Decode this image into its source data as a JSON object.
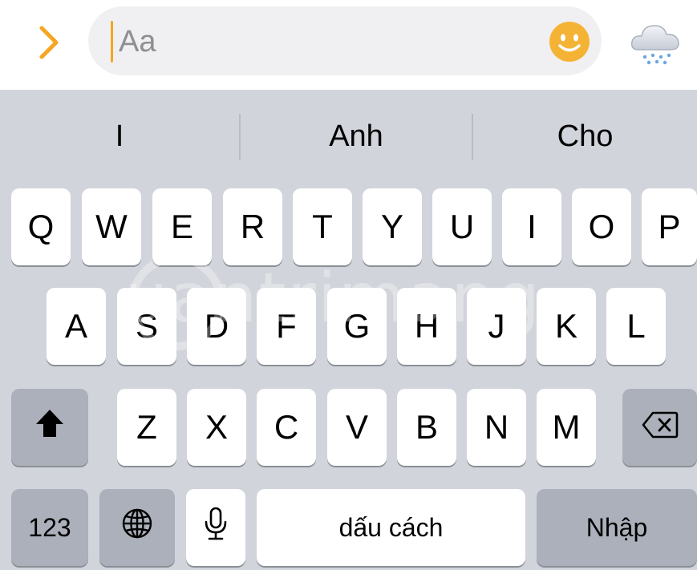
{
  "input_bar": {
    "placeholder": "Aa",
    "expand_icon": "chevron-right-icon",
    "emoji_icon": "smiley-face-icon",
    "weather_icon": "snow-cloud-icon",
    "accent_color": "#f5a623"
  },
  "suggestions": [
    "I",
    "Anh",
    "Cho"
  ],
  "keyboard": {
    "row1": [
      "Q",
      "W",
      "E",
      "R",
      "T",
      "Y",
      "U",
      "I",
      "O",
      "P"
    ],
    "row2": [
      "A",
      "S",
      "D",
      "F",
      "G",
      "H",
      "J",
      "K",
      "L"
    ],
    "row3": [
      "Z",
      "X",
      "C",
      "V",
      "B",
      "N",
      "M"
    ],
    "shift_icon": "shift-arrow-icon",
    "delete_icon": "backspace-icon",
    "numbers_label": "123",
    "globe_icon": "globe-icon",
    "mic_icon": "microphone-icon",
    "space_label": "dấu cách",
    "return_label": "Nhập"
  },
  "watermark": "uantrimang"
}
